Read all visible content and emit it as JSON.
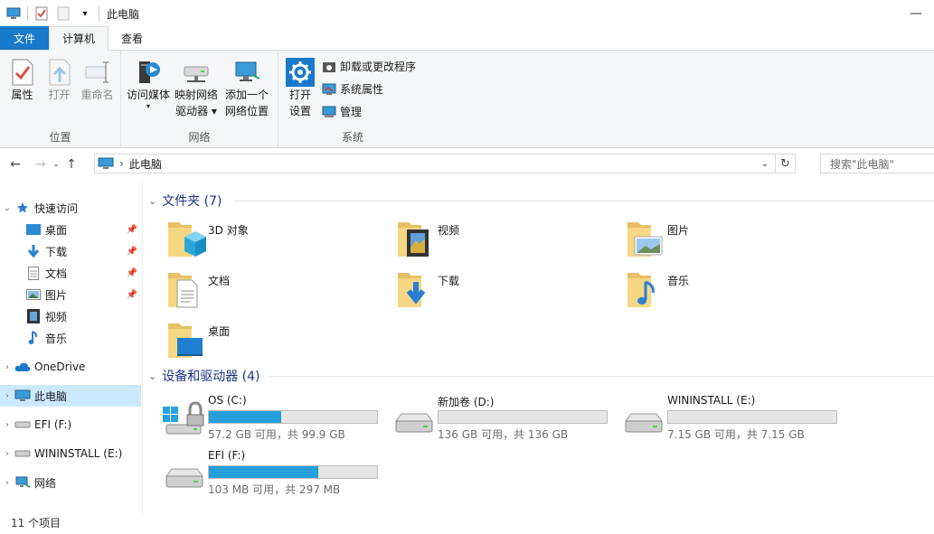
{
  "window": {
    "title": "此电脑",
    "minimize_glyph": "—"
  },
  "ribbon_tabs": [
    {
      "label": "文件"
    },
    {
      "label": "计算机"
    },
    {
      "label": "查看"
    }
  ],
  "ribbon": {
    "location": {
      "label": "位置",
      "properties": "属性",
      "open": "打开",
      "rename": "重命名"
    },
    "network": {
      "label": "网络",
      "access_media": "访问媒体",
      "map_drive": "映射网络\n驱动器 ▾",
      "add_location": "添加一个\n网络位置"
    },
    "system": {
      "label": "系统",
      "open_settings": "打开\n设置",
      "uninstall": "卸载或更改程序",
      "sys_props": "系统属性",
      "manage": "管理"
    }
  },
  "address": {
    "path": "此电脑",
    "separator": "›",
    "search_placeholder": "搜索\"此电脑\""
  },
  "nav_pane": {
    "quick_access": "快速访问",
    "quick_items": [
      {
        "label": "桌面",
        "icon": "desktop-icon"
      },
      {
        "label": "下载",
        "icon": "download-icon"
      },
      {
        "label": "文档",
        "icon": "document-icon"
      },
      {
        "label": "图片",
        "icon": "pictures-icon"
      },
      {
        "label": "视频",
        "icon": "video-icon"
      },
      {
        "label": "音乐",
        "icon": "music-icon"
      }
    ],
    "onedrive": "OneDrive",
    "this_pc": "此电脑",
    "efi": "EFI (F:)",
    "wininstall": "WININSTALL (E:)",
    "network": "网络"
  },
  "folders_section": {
    "title": "文件夹 (7)"
  },
  "folders": [
    {
      "label": "3D 对象"
    },
    {
      "label": "视频"
    },
    {
      "label": "图片"
    },
    {
      "label": "文档"
    },
    {
      "label": "下载"
    },
    {
      "label": "音乐"
    },
    {
      "label": "桌面"
    }
  ],
  "drives_section": {
    "title": "设备和驱动器 (4)"
  },
  "drives": [
    {
      "name": "OS (C:)",
      "space": "57.2 GB 可用，共 99.9 GB",
      "used_fraction": 0.43
    },
    {
      "name": "新加卷 (D:)",
      "space": "136 GB 可用，共 136 GB",
      "used_fraction": 0.0
    },
    {
      "name": "WININSTALL (E:)",
      "space": "7.15 GB 可用，共 7.15 GB",
      "used_fraction": 0.0
    },
    {
      "name": "EFI (F:)",
      "space": "103 MB 可用，共 297 MB",
      "used_fraction": 0.65
    }
  ],
  "status": {
    "items": "11 个项目"
  },
  "colors": {
    "accent": "#1979ca",
    "selection": "#cce8ff",
    "bar_fill": "#26a0da",
    "heading": "#1e3287"
  }
}
